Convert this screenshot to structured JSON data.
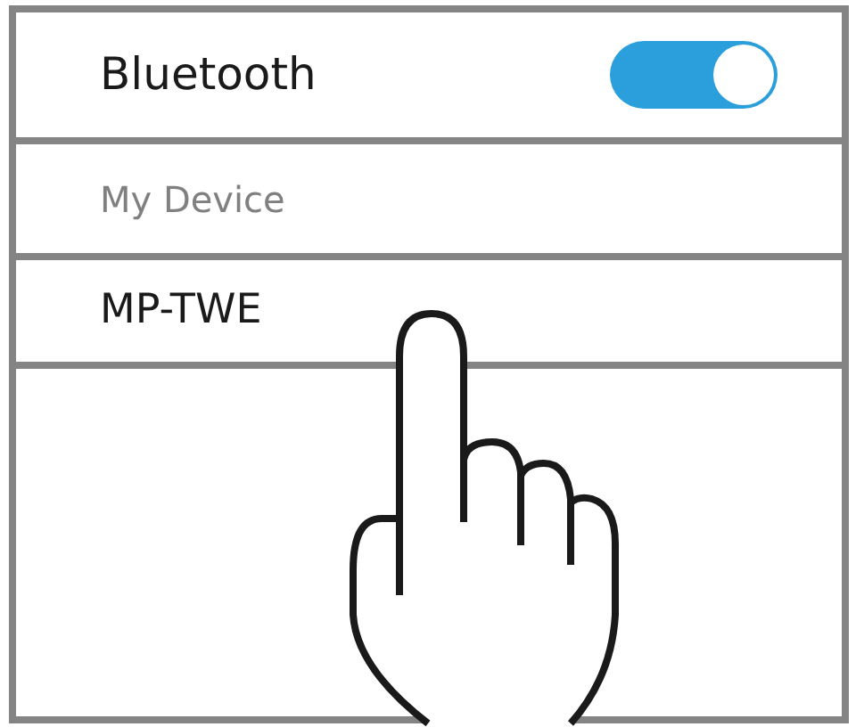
{
  "bluetooth": {
    "label": "Bluetooth",
    "on": true
  },
  "section_header": "My Device",
  "devices": [
    {
      "name": "MP-TWE"
    }
  ]
}
